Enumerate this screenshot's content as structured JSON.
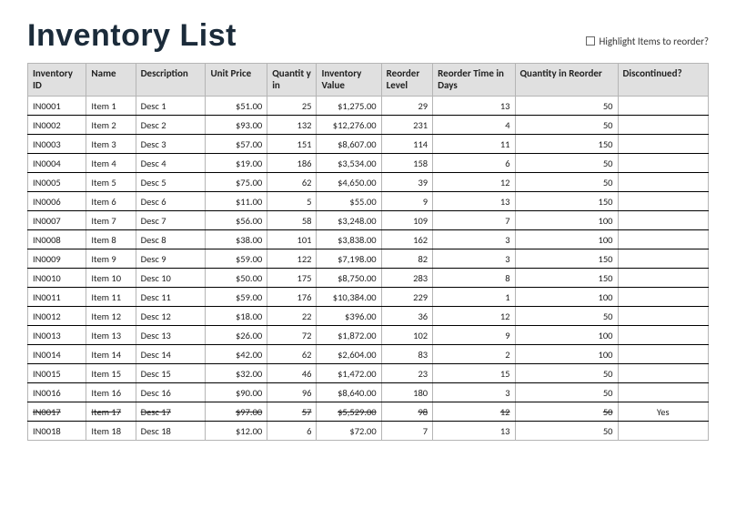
{
  "title": "Inventory List",
  "highlight_label": "Highlight Items to reorder?",
  "columns": {
    "id": "Inventory ID",
    "name": "Name",
    "desc": "Description",
    "uprice": "Unit Price",
    "qty": "Quantit y in",
    "inval": "Inventory Value",
    "rlevel": "Reorder Level",
    "rtime": "Reorder Time in Days",
    "qreord": "Quantity in Reorder",
    "disc": "Discontinued?"
  },
  "rows": [
    {
      "id": "IN0001",
      "name": "Item 1",
      "desc": "Desc 1",
      "uprice": "$51.00",
      "qty": "25",
      "inval": "$1,275.00",
      "rlevel": "29",
      "rtime": "13",
      "qreord": "50",
      "disc": "",
      "discontinued": false
    },
    {
      "id": "IN0002",
      "name": "Item 2",
      "desc": "Desc 2",
      "uprice": "$93.00",
      "qty": "132",
      "inval": "$12,276.00",
      "rlevel": "231",
      "rtime": "4",
      "qreord": "50",
      "disc": "",
      "discontinued": false
    },
    {
      "id": "IN0003",
      "name": "Item 3",
      "desc": "Desc 3",
      "uprice": "$57.00",
      "qty": "151",
      "inval": "$8,607.00",
      "rlevel": "114",
      "rtime": "11",
      "qreord": "150",
      "disc": "",
      "discontinued": false
    },
    {
      "id": "IN0004",
      "name": "Item 4",
      "desc": "Desc 4",
      "uprice": "$19.00",
      "qty": "186",
      "inval": "$3,534.00",
      "rlevel": "158",
      "rtime": "6",
      "qreord": "50",
      "disc": "",
      "discontinued": false
    },
    {
      "id": "IN0005",
      "name": "Item 5",
      "desc": "Desc 5",
      "uprice": "$75.00",
      "qty": "62",
      "inval": "$4,650.00",
      "rlevel": "39",
      "rtime": "12",
      "qreord": "50",
      "disc": "",
      "discontinued": false
    },
    {
      "id": "IN0006",
      "name": "Item 6",
      "desc": "Desc 6",
      "uprice": "$11.00",
      "qty": "5",
      "inval": "$55.00",
      "rlevel": "9",
      "rtime": "13",
      "qreord": "150",
      "disc": "",
      "discontinued": false
    },
    {
      "id": "IN0007",
      "name": "Item 7",
      "desc": "Desc 7",
      "uprice": "$56.00",
      "qty": "58",
      "inval": "$3,248.00",
      "rlevel": "109",
      "rtime": "7",
      "qreord": "100",
      "disc": "",
      "discontinued": false
    },
    {
      "id": "IN0008",
      "name": "Item 8",
      "desc": "Desc 8",
      "uprice": "$38.00",
      "qty": "101",
      "inval": "$3,838.00",
      "rlevel": "162",
      "rtime": "3",
      "qreord": "100",
      "disc": "",
      "discontinued": false
    },
    {
      "id": "IN0009",
      "name": "Item 9",
      "desc": "Desc 9",
      "uprice": "$59.00",
      "qty": "122",
      "inval": "$7,198.00",
      "rlevel": "82",
      "rtime": "3",
      "qreord": "150",
      "disc": "",
      "discontinued": false
    },
    {
      "id": "IN0010",
      "name": "Item 10",
      "desc": "Desc 10",
      "uprice": "$50.00",
      "qty": "175",
      "inval": "$8,750.00",
      "rlevel": "283",
      "rtime": "8",
      "qreord": "150",
      "disc": "",
      "discontinued": false
    },
    {
      "id": "IN0011",
      "name": "Item 11",
      "desc": "Desc 11",
      "uprice": "$59.00",
      "qty": "176",
      "inval": "$10,384.00",
      "rlevel": "229",
      "rtime": "1",
      "qreord": "100",
      "disc": "",
      "discontinued": false
    },
    {
      "id": "IN0012",
      "name": "Item 12",
      "desc": "Desc 12",
      "uprice": "$18.00",
      "qty": "22",
      "inval": "$396.00",
      "rlevel": "36",
      "rtime": "12",
      "qreord": "50",
      "disc": "",
      "discontinued": false
    },
    {
      "id": "IN0013",
      "name": "Item 13",
      "desc": "Desc 13",
      "uprice": "$26.00",
      "qty": "72",
      "inval": "$1,872.00",
      "rlevel": "102",
      "rtime": "9",
      "qreord": "100",
      "disc": "",
      "discontinued": false
    },
    {
      "id": "IN0014",
      "name": "Item 14",
      "desc": "Desc 14",
      "uprice": "$42.00",
      "qty": "62",
      "inval": "$2,604.00",
      "rlevel": "83",
      "rtime": "2",
      "qreord": "100",
      "disc": "",
      "discontinued": false
    },
    {
      "id": "IN0015",
      "name": "Item 15",
      "desc": "Desc 15",
      "uprice": "$32.00",
      "qty": "46",
      "inval": "$1,472.00",
      "rlevel": "23",
      "rtime": "15",
      "qreord": "50",
      "disc": "",
      "discontinued": false
    },
    {
      "id": "IN0016",
      "name": "Item 16",
      "desc": "Desc 16",
      "uprice": "$90.00",
      "qty": "96",
      "inval": "$8,640.00",
      "rlevel": "180",
      "rtime": "3",
      "qreord": "50",
      "disc": "",
      "discontinued": false
    },
    {
      "id": "IN0017",
      "name": "Item 17",
      "desc": "Desc 17",
      "uprice": "$97.00",
      "qty": "57",
      "inval": "$5,529.00",
      "rlevel": "98",
      "rtime": "12",
      "qreord": "50",
      "disc": "Yes",
      "discontinued": true
    },
    {
      "id": "IN0018",
      "name": "Item 18",
      "desc": "Desc 18",
      "uprice": "$12.00",
      "qty": "6",
      "inval": "$72.00",
      "rlevel": "7",
      "rtime": "13",
      "qreord": "50",
      "disc": "",
      "discontinued": false
    }
  ],
  "chart_data": {
    "type": "table",
    "columns": [
      "Inventory ID",
      "Name",
      "Description",
      "Unit Price",
      "Quantity in Stock",
      "Inventory Value",
      "Reorder Level",
      "Reorder Time in Days",
      "Quantity in Reorder",
      "Discontinued?"
    ],
    "rows": [
      [
        "IN0001",
        "Item 1",
        "Desc 1",
        51.0,
        25,
        1275.0,
        29,
        13,
        50,
        ""
      ],
      [
        "IN0002",
        "Item 2",
        "Desc 2",
        93.0,
        132,
        12276.0,
        231,
        4,
        50,
        ""
      ],
      [
        "IN0003",
        "Item 3",
        "Desc 3",
        57.0,
        151,
        8607.0,
        114,
        11,
        150,
        ""
      ],
      [
        "IN0004",
        "Item 4",
        "Desc 4",
        19.0,
        186,
        3534.0,
        158,
        6,
        50,
        ""
      ],
      [
        "IN0005",
        "Item 5",
        "Desc 5",
        75.0,
        62,
        4650.0,
        39,
        12,
        50,
        ""
      ],
      [
        "IN0006",
        "Item 6",
        "Desc 6",
        11.0,
        5,
        55.0,
        9,
        13,
        150,
        ""
      ],
      [
        "IN0007",
        "Item 7",
        "Desc 7",
        56.0,
        58,
        3248.0,
        109,
        7,
        100,
        ""
      ],
      [
        "IN0008",
        "Item 8",
        "Desc 8",
        38.0,
        101,
        3838.0,
        162,
        3,
        100,
        ""
      ],
      [
        "IN0009",
        "Item 9",
        "Desc 9",
        59.0,
        122,
        7198.0,
        82,
        3,
        150,
        ""
      ],
      [
        "IN0010",
        "Item 10",
        "Desc 10",
        50.0,
        175,
        8750.0,
        283,
        8,
        150,
        ""
      ],
      [
        "IN0011",
        "Item 11",
        "Desc 11",
        59.0,
        176,
        10384.0,
        229,
        1,
        100,
        ""
      ],
      [
        "IN0012",
        "Item 12",
        "Desc 12",
        18.0,
        22,
        396.0,
        36,
        12,
        50,
        ""
      ],
      [
        "IN0013",
        "Item 13",
        "Desc 13",
        26.0,
        72,
        1872.0,
        102,
        9,
        100,
        ""
      ],
      [
        "IN0014",
        "Item 14",
        "Desc 14",
        42.0,
        62,
        2604.0,
        83,
        2,
        100,
        ""
      ],
      [
        "IN0015",
        "Item 15",
        "Desc 15",
        32.0,
        46,
        1472.0,
        23,
        15,
        50,
        ""
      ],
      [
        "IN0016",
        "Item 16",
        "Desc 16",
        90.0,
        96,
        8640.0,
        180,
        3,
        50,
        ""
      ],
      [
        "IN0017",
        "Item 17",
        "Desc 17",
        97.0,
        57,
        5529.0,
        98,
        12,
        50,
        "Yes"
      ],
      [
        "IN0018",
        "Item 18",
        "Desc 18",
        12.0,
        6,
        72.0,
        7,
        13,
        50,
        ""
      ]
    ]
  }
}
